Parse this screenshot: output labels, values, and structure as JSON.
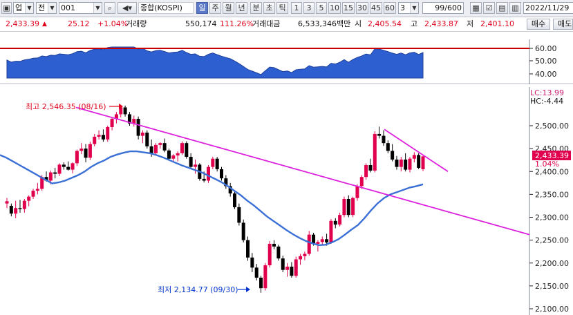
{
  "toolbar": {
    "market_label": "업",
    "view_label": "전",
    "code_value": "001",
    "index_name": "종합(KOSPI)",
    "periods": [
      "일",
      "주",
      "월",
      "년",
      "분",
      "초",
      "틱"
    ],
    "active_period": "일",
    "minutes": [
      "1",
      "3",
      "5",
      "10",
      "15",
      "30",
      "45",
      "60"
    ],
    "minute_select": "3",
    "count": "99",
    "count_total": "/600",
    "date": "2022/11/29"
  },
  "quote": {
    "price": "2,433.39",
    "change": "25.12",
    "change_pct": "+1.04%",
    "volume_label": "거래량",
    "volume": "550,174",
    "volume_ratio": "111.26%",
    "amount_label": "거래대금",
    "amount": "6,533,346백만",
    "open_label": "시",
    "open": "2,405.54",
    "high_label": "고",
    "high": "2,433.87",
    "low_label": "저",
    "low": "2,401.10",
    "buy_button": "매수",
    "sell_button": "매도"
  },
  "indicator": {
    "ticks": [
      "60.00",
      "50.00",
      "40.00"
    ]
  },
  "chart": {
    "high_marker": "최고 2,546.35 (08/16)",
    "low_marker": "최저 2,134.77 (09/30)",
    "lc_label": "LC:13.99",
    "hc_label": "HC:-4.44",
    "current_price_tag": "2,433.39",
    "current_pct_tag": "1.04%",
    "y_ticks": [
      "2,500.00",
      "2,450.00",
      "2,400.00",
      "2,350.00",
      "2,300.00",
      "2,250.00",
      "2,200.00",
      "2,150.00",
      "2,100.00"
    ]
  },
  "colors": {
    "up": "#e0004d",
    "down": "#000000",
    "ma": "#3a6fd6",
    "trend": "#dd22dd",
    "indicator_fill": "#2d5fd0",
    "ref_line": "#cc0000"
  },
  "chart_data": {
    "type": "candlestick",
    "ohlc": [
      [
        2330,
        2342,
        2320,
        2335
      ],
      [
        2325,
        2330,
        2302,
        2308
      ],
      [
        2308,
        2336,
        2298,
        2320
      ],
      [
        2320,
        2338,
        2310,
        2318
      ],
      [
        2318,
        2340,
        2310,
        2336
      ],
      [
        2336,
        2348,
        2324,
        2345
      ],
      [
        2345,
        2362,
        2340,
        2358
      ],
      [
        2358,
        2375,
        2350,
        2362
      ],
      [
        2362,
        2392,
        2358,
        2388
      ],
      [
        2388,
        2400,
        2378,
        2380
      ],
      [
        2380,
        2402,
        2372,
        2398
      ],
      [
        2398,
        2408,
        2385,
        2395
      ],
      [
        2395,
        2418,
        2390,
        2415
      ],
      [
        2415,
        2420,
        2404,
        2410
      ],
      [
        2410,
        2422,
        2402,
        2404
      ],
      [
        2404,
        2420,
        2396,
        2418
      ],
      [
        2418,
        2448,
        2412,
        2445
      ],
      [
        2445,
        2462,
        2438,
        2450
      ],
      [
        2450,
        2460,
        2420,
        2430
      ],
      [
        2430,
        2465,
        2425,
        2460
      ],
      [
        2460,
        2482,
        2455,
        2476
      ],
      [
        2476,
        2490,
        2470,
        2480
      ],
      [
        2480,
        2492,
        2465,
        2470
      ],
      [
        2470,
        2500,
        2465,
        2497
      ],
      [
        2497,
        2518,
        2490,
        2515
      ],
      [
        2515,
        2530,
        2505,
        2525
      ],
      [
        2525,
        2546,
        2518,
        2540
      ],
      [
        2540,
        2544,
        2520,
        2525
      ],
      [
        2525,
        2530,
        2500,
        2505
      ],
      [
        2505,
        2522,
        2498,
        2515
      ],
      [
        2515,
        2520,
        2470,
        2478
      ],
      [
        2478,
        2490,
        2462,
        2485
      ],
      [
        2485,
        2490,
        2450,
        2455
      ],
      [
        2455,
        2470,
        2432,
        2440
      ],
      [
        2440,
        2462,
        2435,
        2458
      ],
      [
        2458,
        2464,
        2450,
        2462
      ],
      [
        2462,
        2472,
        2442,
        2446
      ],
      [
        2446,
        2450,
        2425,
        2428
      ],
      [
        2428,
        2438,
        2420,
        2435
      ],
      [
        2435,
        2444,
        2422,
        2440
      ],
      [
        2440,
        2466,
        2436,
        2462
      ],
      [
        2462,
        2466,
        2428,
        2432
      ],
      [
        2432,
        2440,
        2405,
        2410
      ],
      [
        2410,
        2426,
        2395,
        2415
      ],
      [
        2415,
        2418,
        2380,
        2384
      ],
      [
        2384,
        2400,
        2376,
        2380
      ],
      [
        2380,
        2414,
        2375,
        2410
      ],
      [
        2410,
        2432,
        2405,
        2428
      ],
      [
        2428,
        2432,
        2400,
        2405
      ],
      [
        2405,
        2410,
        2380,
        2385
      ],
      [
        2385,
        2392,
        2362,
        2368
      ],
      [
        2368,
        2375,
        2345,
        2352
      ],
      [
        2352,
        2358,
        2318,
        2322
      ],
      [
        2322,
        2330,
        2282,
        2288
      ],
      [
        2288,
        2295,
        2245,
        2250
      ],
      [
        2250,
        2258,
        2205,
        2212
      ],
      [
        2212,
        2222,
        2180,
        2190
      ],
      [
        2190,
        2198,
        2162,
        2168
      ],
      [
        2168,
        2172,
        2135,
        2145
      ],
      [
        2145,
        2200,
        2140,
        2195
      ],
      [
        2195,
        2248,
        2190,
        2242
      ],
      [
        2242,
        2250,
        2230,
        2236
      ],
      [
        2236,
        2240,
        2205,
        2210
      ],
      [
        2210,
        2216,
        2180,
        2185
      ],
      [
        2185,
        2200,
        2170,
        2192
      ],
      [
        2192,
        2202,
        2168,
        2172
      ],
      [
        2172,
        2214,
        2168,
        2208
      ],
      [
        2208,
        2220,
        2196,
        2215
      ],
      [
        2215,
        2225,
        2206,
        2220
      ],
      [
        2220,
        2270,
        2216,
        2262
      ],
      [
        2262,
        2266,
        2238,
        2242
      ],
      [
        2242,
        2250,
        2225,
        2246
      ],
      [
        2246,
        2258,
        2240,
        2252
      ],
      [
        2252,
        2264,
        2238,
        2245
      ],
      [
        2245,
        2296,
        2242,
        2292
      ],
      [
        2292,
        2298,
        2276,
        2284
      ],
      [
        2284,
        2310,
        2280,
        2305
      ],
      [
        2305,
        2345,
        2300,
        2340
      ],
      [
        2340,
        2348,
        2300,
        2305
      ],
      [
        2305,
        2345,
        2300,
        2342
      ],
      [
        2342,
        2372,
        2336,
        2368
      ],
      [
        2368,
        2392,
        2362,
        2388
      ],
      [
        2388,
        2418,
        2382,
        2414
      ],
      [
        2414,
        2428,
        2398,
        2402
      ],
      [
        2402,
        2488,
        2398,
        2482
      ],
      [
        2482,
        2498,
        2472,
        2478
      ],
      [
        2478,
        2490,
        2456,
        2462
      ],
      [
        2462,
        2468,
        2440,
        2445
      ],
      [
        2445,
        2460,
        2422,
        2426
      ],
      [
        2426,
        2434,
        2404,
        2410
      ],
      [
        2410,
        2432,
        2400,
        2426
      ],
      [
        2426,
        2440,
        2400,
        2404
      ],
      [
        2404,
        2432,
        2398,
        2428
      ],
      [
        2428,
        2442,
        2420,
        2436
      ],
      [
        2436,
        2440,
        2405,
        2408
      ],
      [
        2405,
        2434,
        2401,
        2433
      ]
    ],
    "moving_average": [
      2436,
      2430,
      2422,
      2414,
      2406,
      2398,
      2390,
      2382,
      2374,
      2376,
      2380,
      2386,
      2392,
      2400,
      2410,
      2418,
      2424,
      2432,
      2437,
      2441,
      2444,
      2444,
      2442,
      2440,
      2436,
      2431,
      2425,
      2419,
      2413,
      2408,
      2403,
      2398,
      2391,
      2384,
      2377,
      2368,
      2358,
      2348,
      2336,
      2326,
      2314,
      2302,
      2292,
      2282,
      2272,
      2263,
      2255,
      2248,
      2243,
      2239,
      2240,
      2245,
      2252,
      2262,
      2273,
      2283,
      2298,
      2315,
      2330,
      2342,
      2350,
      2355,
      2360,
      2365,
      2368,
      2372
    ],
    "trend_lines": [
      {
        "from": [
          0,
          2540
        ],
        "to": [
          1,
          2262
        ]
      },
      {
        "from": [
          0.78,
          2492
        ],
        "to": [
          0.95,
          2400
        ]
      }
    ],
    "ylim": [
      2100,
      2550
    ],
    "high": 2546.35,
    "low": 2134.77
  }
}
